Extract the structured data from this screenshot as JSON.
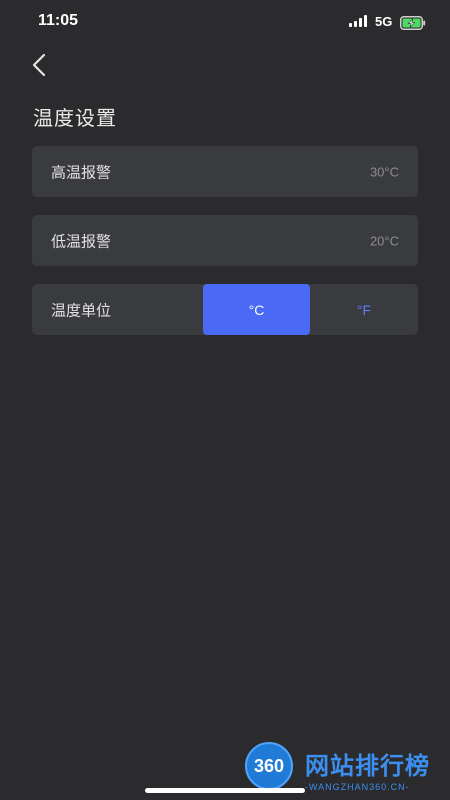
{
  "status_bar": {
    "time": "11:05",
    "network": "5G",
    "signal_icon": "signal-bars-icon",
    "battery_icon": "battery-charging-icon"
  },
  "nav": {
    "back_icon": "chevron-left-icon"
  },
  "page": {
    "title": "温度设置"
  },
  "settings": {
    "high_alarm": {
      "label": "高温报警",
      "value": "30°C"
    },
    "low_alarm": {
      "label": "低温报警",
      "value": "20°C"
    },
    "unit": {
      "label": "温度单位",
      "options": [
        "°C",
        "°F"
      ],
      "selected": "°C"
    }
  },
  "watermark": {
    "logo_text": "360",
    "title": "网站排行榜",
    "subtitle": "-WANGZHAN360.CN-"
  },
  "colors": {
    "background": "#2b2b2d",
    "card": "#3a3b3e",
    "accent": "#4a6af5",
    "accent_text": "#5b7bff",
    "battery_green": "#4cd964"
  }
}
